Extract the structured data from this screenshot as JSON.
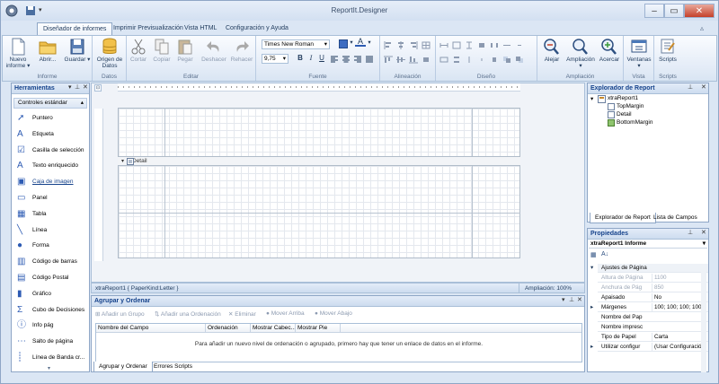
{
  "window": {
    "title": "ReportIt.Designer",
    "min": "–",
    "max": "▭",
    "close": "✕"
  },
  "tabs": [
    "Diseñador de informes",
    "Imprimir Previsualización",
    "Vista HTML",
    "Configuración y Ayuda"
  ],
  "ribbon": {
    "groups": {
      "informe": "Informe",
      "datos": "Datos",
      "editar": "Editar",
      "fuente": "Fuente",
      "alineacion": "Alineación",
      "diseno": "Diseño",
      "ampliacion": "Ampliación",
      "vista": "Vista",
      "scripts": "Scripts"
    },
    "nuevo": "Nuevo informe ▾",
    "abrir": "Abrir...",
    "guardar": "Guardar ▾",
    "origen": "Origen de Datos",
    "cortar": "Cortar",
    "copiar": "Copiar",
    "pegar": "Pegar",
    "deshacer": "Deshacer",
    "rehacer": "Rehacer",
    "font_name": "Times New Roman",
    "font_size": "9,75",
    "alejar": "Alejar",
    "ampliacion_btn": "Ampliación ▾",
    "acercar": "Acercar",
    "ventanas": "Ventanas ▾",
    "scripts_btn": "Scripts"
  },
  "toolbox": {
    "title": "Herramientas",
    "section": "Controles estándar",
    "items": [
      "Puntero",
      "Etiqueta",
      "Casilla de selección",
      "Texto enriquecido",
      "Caja de imagen",
      "Panel",
      "Tabla",
      "Línea",
      "Forma",
      "Código de barras",
      "Código Postal",
      "Gráfico",
      "Cubo de Decisiones",
      "Info pág",
      "Salto de página",
      "Línea de Banda cr..."
    ]
  },
  "designer": {
    "band": "Detail",
    "status_left": "xtraReport1 { PaperKind:Letter }",
    "status_right": "Ampliación: 100%"
  },
  "grouping": {
    "title": "Agrupar y Ordenar",
    "buttons": [
      "Añadir un Grupo",
      "Añadir una Ordenación",
      "Eliminar",
      "Mover Arriba",
      "Mover Abajo"
    ],
    "columns": [
      "Nombre del Campo",
      "Ordenación",
      "Mostrar Cabec...",
      "Mostrar Pie"
    ],
    "empty": "Para añadir un nuevo nivel de ordenación o agrupado, primero hay que tener un enlace de datos en el informe.",
    "tabs": [
      "Agrupar y Ordenar",
      "Errores Scripts"
    ]
  },
  "explorer": {
    "title": "Explorador de Report",
    "root": "xtraReport1",
    "children": [
      "TopMargin",
      "Detail",
      "BottomMargin"
    ],
    "tabs": [
      "Explorador de Report",
      "Lista de Campos"
    ]
  },
  "properties": {
    "title": "Propiedades",
    "object": "xtraReport1  Informe",
    "rows": [
      {
        "n": "Ajustes de Página",
        "v": ""
      },
      {
        "n": "Altura de Página",
        "v": "1100"
      },
      {
        "n": "Anchura de Pág",
        "v": "850"
      },
      {
        "n": "Apaisado",
        "v": "No"
      },
      {
        "n": "Márgenes",
        "v": "100; 100; 100; 100"
      },
      {
        "n": "Nombre del Pap",
        "v": ""
      },
      {
        "n": "Nombre impresc",
        "v": ""
      },
      {
        "n": "Tipo de Papel",
        "v": "Carta"
      },
      {
        "n": "Utilizar configur",
        "v": "(Usar Configuració..."
      }
    ]
  },
  "colors": {
    "accent": "#15428b",
    "ribbon_bg": "#e4ecf7",
    "close": "#c4402a"
  }
}
